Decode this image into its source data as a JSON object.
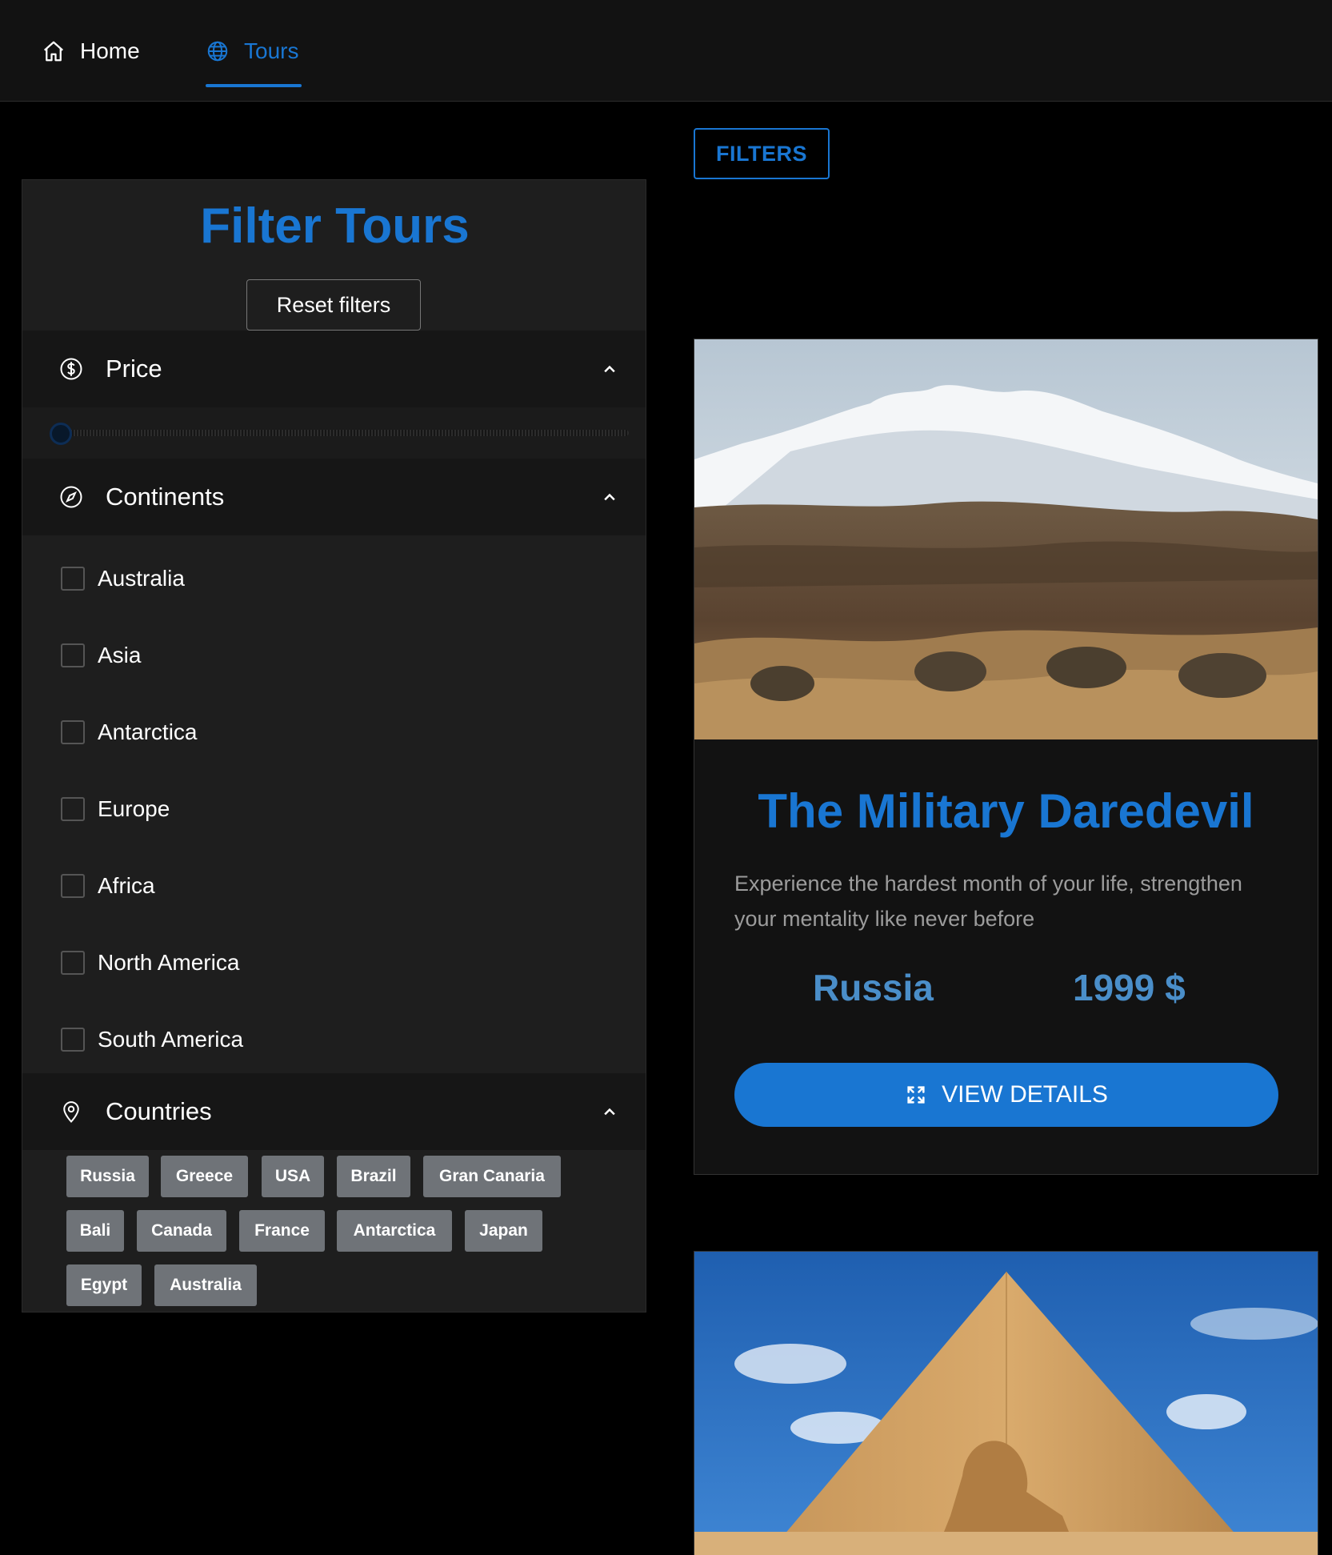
{
  "nav": {
    "items": [
      {
        "label": "Home",
        "icon": "home-icon",
        "active": false
      },
      {
        "label": "Tours",
        "icon": "globe-icon",
        "active": true
      }
    ],
    "accent": "#1976d2"
  },
  "filters_button": {
    "label": "FILTERS"
  },
  "filter_panel": {
    "title": "Filter Tours",
    "reset_label": "Reset filters",
    "price": {
      "label": "Price",
      "icon": "dollar-icon",
      "slider_value": 0
    },
    "continents": {
      "label": "Continents",
      "icon": "compass-icon",
      "items": [
        "Australia",
        "Asia",
        "Antarctica",
        "Europe",
        "Africa",
        "North America",
        "South America"
      ]
    },
    "countries": {
      "label": "Countries",
      "icon": "location-pin-icon",
      "items": [
        "Russia",
        "Greece",
        "USA",
        "Brazil",
        "Gran Canaria",
        "Bali",
        "Canada",
        "France",
        "Antarctica",
        "Japan",
        "Egypt",
        "Australia"
      ]
    }
  },
  "tours": [
    {
      "title": "The Military Daredevil",
      "description": "Experience the hardest month of your life, strengthen your mentality like never before",
      "country": "Russia",
      "price": "1999 $",
      "button": "VIEW DETAILS",
      "image": "mountain-soldiers-photo"
    },
    {
      "image": "pyramid-sphinx-photo"
    }
  ]
}
